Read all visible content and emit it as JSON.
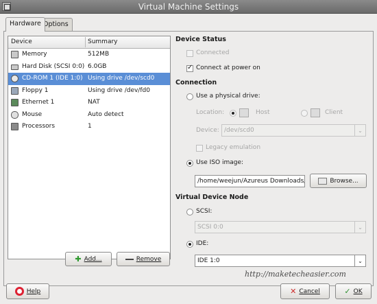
{
  "window": {
    "title": "Virtual Machine Settings"
  },
  "tabs": [
    {
      "label": "Hardware"
    },
    {
      "label": "Options"
    }
  ],
  "device_list": {
    "headers": {
      "device": "Device",
      "summary": "Summary"
    },
    "rows": [
      {
        "device": "Memory",
        "summary": "512MB",
        "icon": "memory-icon"
      },
      {
        "device": "Hard Disk (SCSI 0:0)",
        "summary": "6.0GB",
        "icon": "hard-disk-icon"
      },
      {
        "device": "CD-ROM 1 (IDE 1:0)",
        "summary": "Using drive /dev/scd0",
        "icon": "cdrom-icon",
        "selected": true
      },
      {
        "device": "Floppy 1",
        "summary": "Using drive /dev/fd0",
        "icon": "floppy-icon"
      },
      {
        "device": "Ethernet 1",
        "summary": "NAT",
        "icon": "ethernet-icon"
      },
      {
        "device": "Mouse",
        "summary": "Auto detect",
        "icon": "mouse-icon"
      },
      {
        "device": "Processors",
        "summary": "1",
        "icon": "processor-icon"
      }
    ]
  },
  "list_buttons": {
    "add": "Add...",
    "remove": "Remove"
  },
  "device_status": {
    "heading": "Device Status",
    "connected": "Connected",
    "connect_at_power_on": "Connect at power on"
  },
  "connection": {
    "heading": "Connection",
    "physical_drive": "Use a physical drive:",
    "location_label": "Location:",
    "host": "Host",
    "client": "Client",
    "device_label": "Device:",
    "device_value": "/dev/scd0",
    "legacy_emulation": "Legacy emulation",
    "iso_image": "Use ISO image:",
    "iso_path": "/home/weejun/Azureus Downloads/",
    "browse": "Browse..."
  },
  "virtual_device_node": {
    "heading": "Virtual Device Node",
    "scsi": "SCSI:",
    "scsi_value": "SCSI 0:0",
    "ide": "IDE:",
    "ide_value": "IDE 1:0"
  },
  "footer": {
    "watermark": "http://maketecheasier.com",
    "help": "Help",
    "cancel": "Cancel",
    "ok": "OK"
  },
  "colors": {
    "selection": "#5a8ed6",
    "titlebar": "#7a7a7a"
  }
}
